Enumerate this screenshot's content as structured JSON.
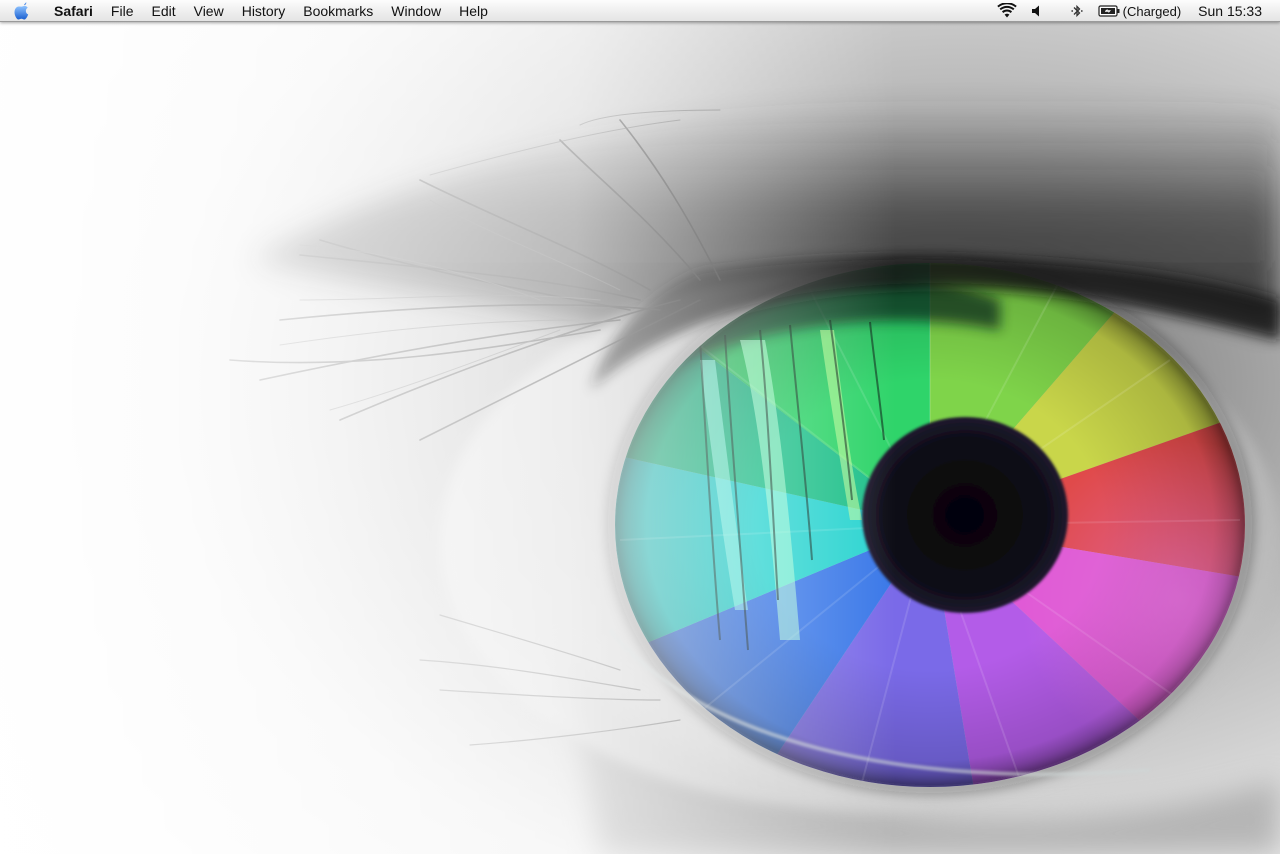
{
  "menubar": {
    "apple_icon": "apple-logo-icon",
    "app_name": "Safari",
    "menus": [
      "File",
      "Edit",
      "View",
      "History",
      "Bookmarks",
      "Window",
      "Help"
    ],
    "extras": {
      "wifi_icon": "wifi-icon",
      "volume_icon": "speaker-volume-icon",
      "bluetooth_icon": "bluetooth-icon",
      "battery_icon": "battery-icon",
      "battery_status": "(Charged)"
    },
    "clock": "Sun 15:33"
  },
  "desktop": {
    "wallpaper": "close-up-rainbow-eye",
    "colors": {
      "background": "#f2f2f2",
      "pupil": "#0b0a14",
      "iris_green": "#2fd46a",
      "iris_cyan": "#2ad4d0",
      "iris_blue": "#3a78e8",
      "iris_violet": "#9a5ce8",
      "iris_magenta": "#e05ad6",
      "iris_red": "#e04a4a",
      "iris_yellow": "#c9d64a"
    }
  }
}
